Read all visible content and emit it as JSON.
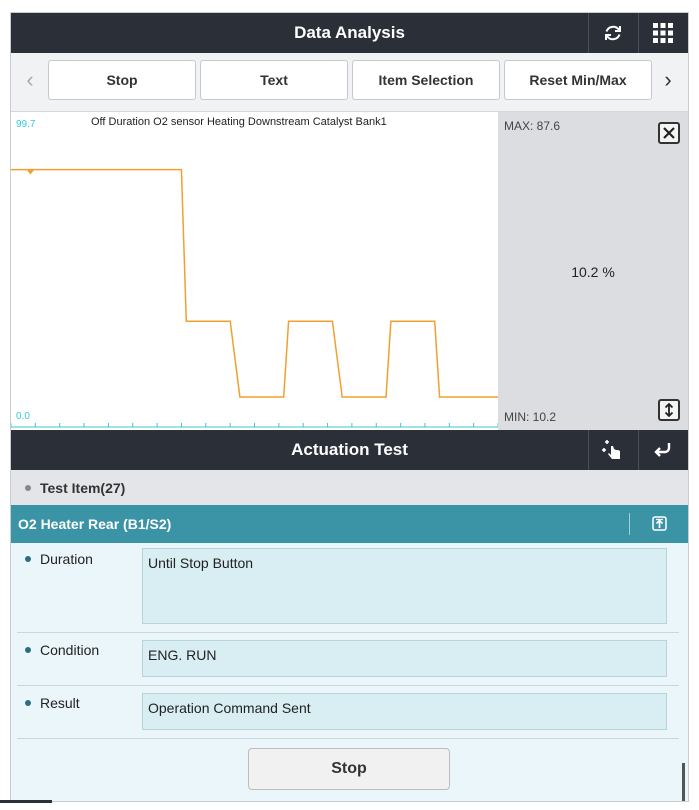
{
  "header": {
    "title": "Data Analysis",
    "refresh_icon": "refresh-icon",
    "menu_icon": "grid-menu-icon"
  },
  "toolbar": {
    "prev_arrow": "‹",
    "next_arrow": "›",
    "buttons": [
      {
        "label": "Stop"
      },
      {
        "label": "Text"
      },
      {
        "label": "Item Selection"
      },
      {
        "label": "Reset Min/Max"
      }
    ]
  },
  "graph": {
    "item_title": "Off Duration O2 sensor Heating Downstream Catalyst Bank1",
    "y_max_label": "99.7",
    "y_min_label": "0.0",
    "max_text": "MAX: 87.6",
    "min_text": "MIN: 10.2",
    "current_value": "10.2 %",
    "line_color": "#f0a030",
    "axis_color": "#35c9d6",
    "close_icon": "close-icon",
    "resize_icon": "expand-vertical-icon"
  },
  "chart_data": {
    "type": "line",
    "series": [
      {
        "values": [
          87.6,
          87.6,
          87.6,
          87.6,
          36.0,
          36.0,
          10.2,
          10.2,
          36.0,
          36.0,
          10.2,
          10.2,
          36.0,
          36.0,
          10.2,
          10.2,
          10.2
        ]
      }
    ],
    "x": [
      0,
      2,
      18,
      35,
      36,
      45,
      47,
      56,
      57,
      66,
      68,
      77,
      78,
      87,
      88,
      97,
      100
    ],
    "ylim": [
      0.0,
      99.7
    ]
  },
  "actuation": {
    "title": "Actuation Test",
    "gesture_icon": "touch-gesture-icon",
    "back_icon": "return-icon",
    "test_item": "Test Item(27)",
    "selected": "O2 Heater Rear (B1/S2)",
    "collapse_icon": "collapse-up-icon",
    "rows": [
      {
        "label": "Duration",
        "value": "Until Stop Button"
      },
      {
        "label": "Condition",
        "value": "ENG. RUN"
      },
      {
        "label": "Result",
        "value": "Operation Command Sent"
      }
    ],
    "stop_label": "Stop"
  }
}
